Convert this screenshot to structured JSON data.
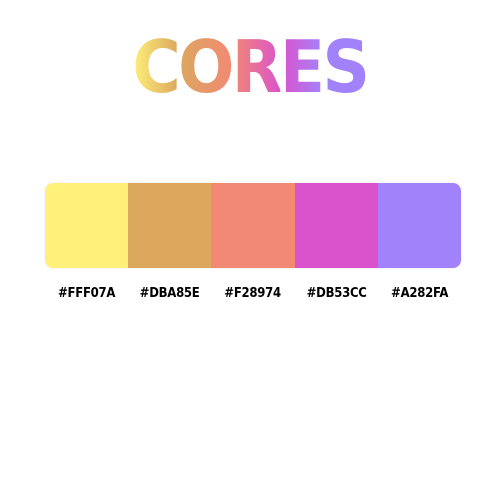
{
  "title": {
    "letters": [
      "C",
      "O",
      "R",
      "E",
      "S"
    ],
    "letter_colors": [
      "#FFF07A",
      "#DBA85E",
      "#F28974",
      "#DB53CC",
      "#A282FA"
    ]
  },
  "palette": {
    "swatches": [
      {
        "hex": "#FFF07A",
        "label": "#FFF07A"
      },
      {
        "hex": "#DBA85E",
        "label": "#DBA85E"
      },
      {
        "hex": "#F28974",
        "label": "#F28974"
      },
      {
        "hex": "#DB53CC",
        "label": "#DB53CC"
      },
      {
        "hex": "#A282FA",
        "label": "#A282FA"
      }
    ]
  }
}
